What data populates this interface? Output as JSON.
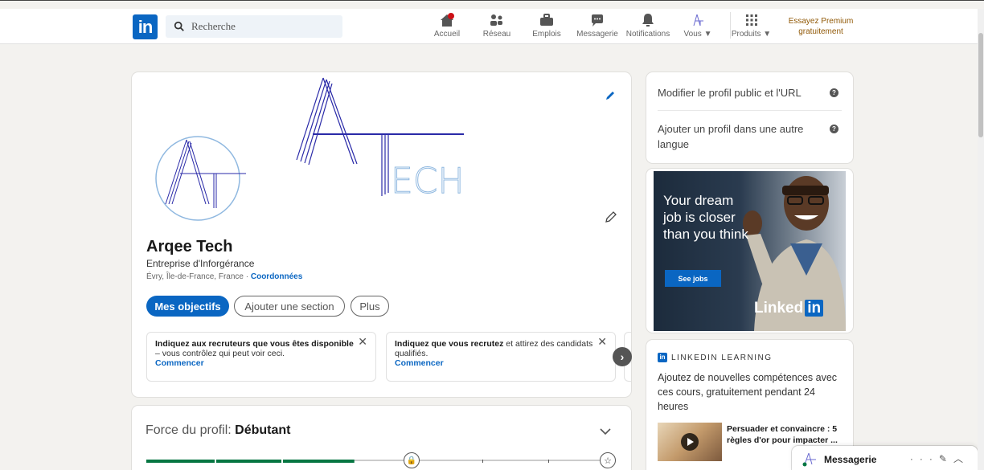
{
  "nav": {
    "search_placeholder": "Recherche",
    "items": [
      {
        "label": "Accueil",
        "icon": "home-icon"
      },
      {
        "label": "Réseau",
        "icon": "network-icon"
      },
      {
        "label": "Emplois",
        "icon": "briefcase-icon"
      },
      {
        "label": "Messagerie",
        "icon": "chat-icon"
      },
      {
        "label": "Notifications",
        "icon": "bell-icon"
      },
      {
        "label": "Vous",
        "icon": "avatar-icon"
      },
      {
        "label": "Produits",
        "icon": "grid-icon"
      }
    ],
    "premium_line1": "Essayez Premium",
    "premium_line2": "gratuitement",
    "brand_color": "#0a66c2",
    "notification_badge_color": "#cc1016"
  },
  "profile": {
    "name": "Arqee Tech",
    "tagline": "Entreprise d'Inforgérance",
    "location": "Évry, Île-de-France, France ·",
    "contact_link": "Coordonnées",
    "logo_text": "ECH",
    "buttons": {
      "primary": "Mes objectifs",
      "add_section": "Ajouter une section",
      "more": "Plus"
    },
    "hints": [
      {
        "bold": "Indiquez aux recruteurs que vous êtes disponible",
        "text": "– vous contrôlez qui peut voir ceci.",
        "action": "Commencer"
      },
      {
        "prefix": "Indiquez que vous",
        "bold": "recrutez",
        "text": "et attirez des candidats qualifiés.",
        "action": "Commencer"
      }
    ]
  },
  "strength": {
    "label": "Force du profil:",
    "level": "Débutant",
    "progress_fraction": 0.45
  },
  "sidebar": {
    "edit_public": "Modifier le profil public et l'URL",
    "add_language": "Ajouter un profil dans une autre langue"
  },
  "ad": {
    "text": "Your dream job is closer than you think",
    "button": "See jobs",
    "logo_word": "Linked",
    "logo_in": "in"
  },
  "learning": {
    "heading": "LINKEDIN LEARNING",
    "description": "Ajoutez de nouvelles compétences avec ces cours, gratuitement pendant 24 heures",
    "course_title": "Persuader et convaincre : 5 règles d'or pour impacter ..."
  },
  "messaging": {
    "label": "Messagerie"
  }
}
